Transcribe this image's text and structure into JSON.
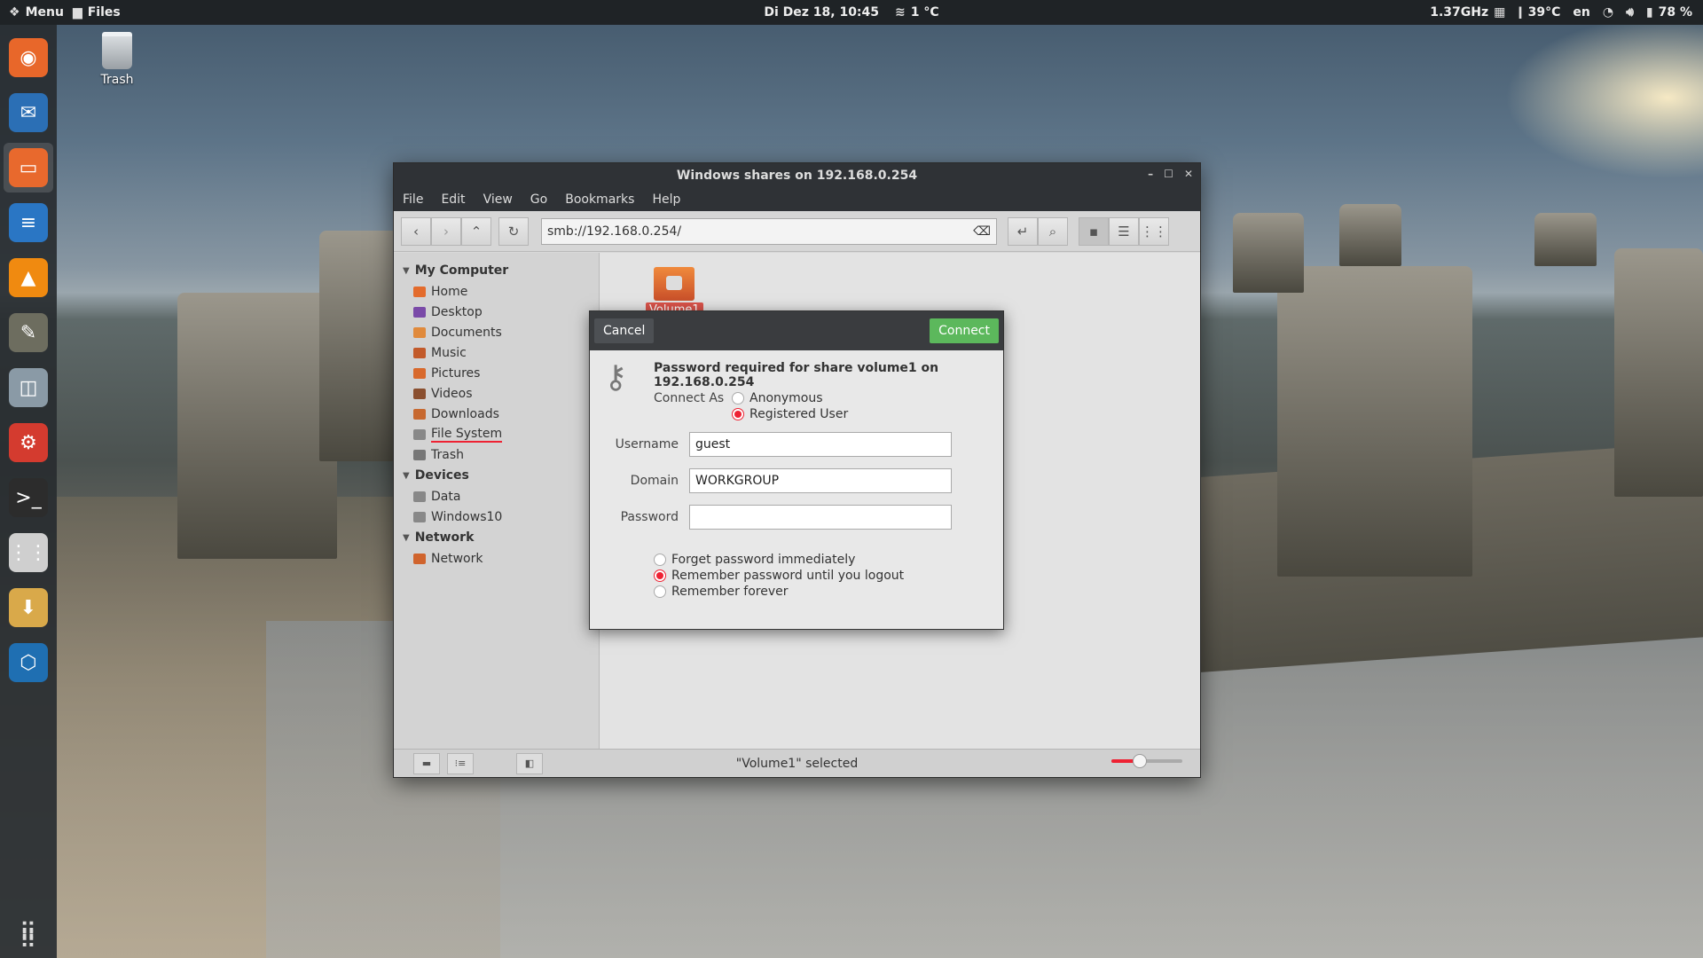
{
  "top_panel": {
    "menu_label": "Menu",
    "active_app": "Files",
    "datetime": "Di Dez 18, 10:45",
    "weather": "1 °C",
    "cpu_freq": "1.37GHz",
    "temperature": "39°C",
    "keyboard_layout": "en",
    "battery": "78 %"
  },
  "desktop": {
    "trash_label": "Trash"
  },
  "dock": {
    "items": [
      {
        "icon": "firefox-icon",
        "color": "#e8672a"
      },
      {
        "icon": "thunderbird-icon",
        "color": "#2b6fb5"
      },
      {
        "icon": "files-icon",
        "color": "#e8692d"
      },
      {
        "icon": "writer-icon",
        "color": "#2a76c4"
      },
      {
        "icon": "vlc-icon",
        "color": "#f08a10"
      },
      {
        "icon": "gimp-icon",
        "color": "#6d6d5f"
      },
      {
        "icon": "software-center-icon",
        "color": "#8a9aa6"
      },
      {
        "icon": "settings-icon",
        "color": "#d43b2f"
      },
      {
        "icon": "terminal-icon",
        "color": "#2c2c2c"
      },
      {
        "icon": "mixer-icon",
        "color": "#cfcfcf"
      },
      {
        "icon": "archive-icon",
        "color": "#d9a94a"
      },
      {
        "icon": "virtualbox-icon",
        "color": "#1f6fb2"
      }
    ]
  },
  "window": {
    "title": "Windows shares on 192.168.0.254",
    "menu": [
      "File",
      "Edit",
      "View",
      "Go",
      "Bookmarks",
      "Help"
    ],
    "location": "smb://192.168.0.254/",
    "sidebar": {
      "sections": [
        {
          "title": "My Computer",
          "items": [
            {
              "label": "Home",
              "color": "#e36b2c"
            },
            {
              "label": "Desktop",
              "color": "#7a4aa8"
            },
            {
              "label": "Documents",
              "color": "#e08a3c"
            },
            {
              "label": "Music",
              "color": "#c25a2a"
            },
            {
              "label": "Pictures",
              "color": "#d8692c"
            },
            {
              "label": "Videos",
              "color": "#8a4f2f"
            },
            {
              "label": "Downloads",
              "color": "#c76930"
            },
            {
              "label": "File System",
              "color": "#888888"
            },
            {
              "label": "Trash",
              "color": "#777777"
            }
          ]
        },
        {
          "title": "Devices",
          "items": [
            {
              "label": "Data",
              "color": "#888888"
            },
            {
              "label": "Windows10",
              "color": "#888888"
            }
          ]
        },
        {
          "title": "Network",
          "items": [
            {
              "label": "Network",
              "color": "#d0642d"
            }
          ]
        }
      ]
    },
    "file_label": "Volume1",
    "status": "\"Volume1\" selected",
    "zoom_level": 0.4
  },
  "dialog": {
    "cancel_label": "Cancel",
    "connect_label": "Connect",
    "title": "Password required for share volume1 on 192.168.0.254",
    "connect_as_label": "Connect As",
    "connect_as_options": [
      "Anonymous",
      "Registered User"
    ],
    "connect_as_selected": 1,
    "username_label": "Username",
    "username_value": "guest",
    "domain_label": "Domain",
    "domain_value": "WORKGROUP",
    "password_label": "Password",
    "password_value": "",
    "remember_options": [
      "Forget password immediately",
      "Remember password until you logout",
      "Remember forever"
    ],
    "remember_selected": 1
  }
}
